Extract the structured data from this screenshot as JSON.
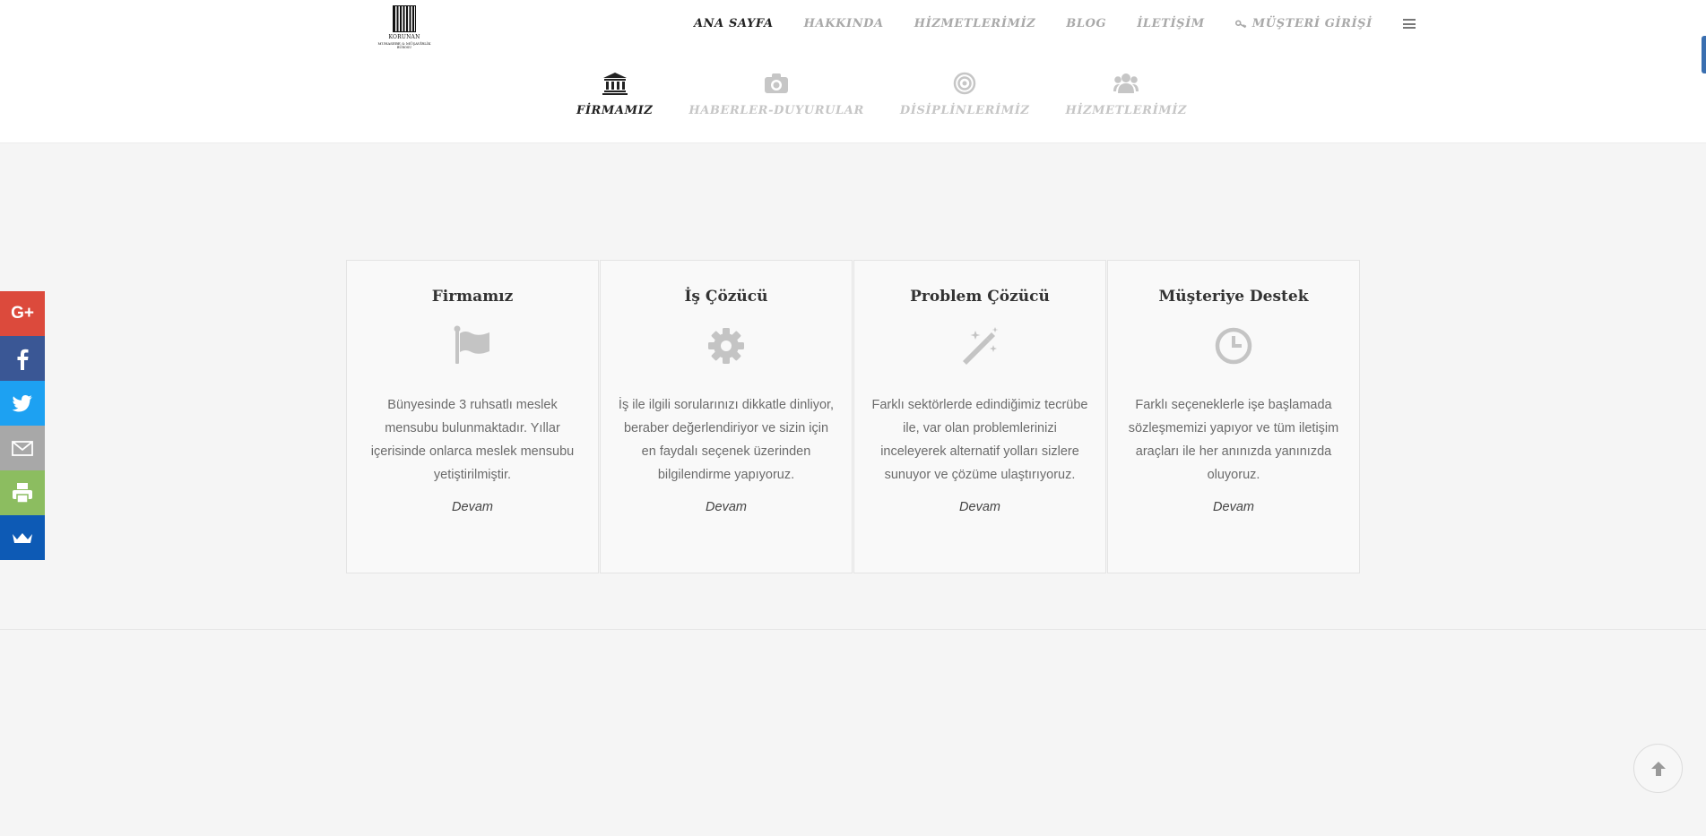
{
  "logo": {
    "name": "KORUNAN",
    "line1": "MUHASEBE & MÜŞAVİRLİK",
    "line2": "BÜROSU"
  },
  "nav": {
    "items": [
      {
        "label": "ANA SAYFA",
        "active": true
      },
      {
        "label": "HAKKINDA"
      },
      {
        "label": "HİZMETLERİMİZ"
      },
      {
        "label": "BLOG"
      },
      {
        "label": "İLETİŞİM"
      },
      {
        "label": "MÜŞTERİ GİRİŞİ",
        "icon": "key-icon"
      }
    ],
    "menu_icon": "hamburger-menu-icon"
  },
  "subtabs": [
    {
      "label": "FİRMAMIZ",
      "icon": "bank-icon",
      "active": true
    },
    {
      "label": "HABERLER-DUYURULAR",
      "icon": "camera-icon"
    },
    {
      "label": "DİSİPLİNLERİMİZ",
      "icon": "target-icon"
    },
    {
      "label": "HİZMETLERİMİZ",
      "icon": "users-icon"
    }
  ],
  "features": [
    {
      "title": "Firmamız",
      "icon": "flag-icon",
      "text": "Bünyesinde 3 ruhsatlı meslek mensubu bulunmaktadır. Yıllar içerisinde onlarca meslek mensubu yetiştirilmiştir.",
      "link": "Devam"
    },
    {
      "title": "İş Çözücü",
      "icon": "gear-icon",
      "text": "İş ile ilgili sorularınızı dikkatle dinliyor, beraber değerlendiriyor ve sizin için en faydalı seçenek üzerinden bilgilendirme yapıyoruz.",
      "link": "Devam"
    },
    {
      "title": "Problem Çözücü",
      "icon": "magic-wand-icon",
      "text": "Farklı sektörlerde edindiğimiz tecrübe ile, var olan problemlerinizi inceleyerek alternatif yolları sizlere sunuyor ve çözüme ulaştırıyoruz.",
      "link": "Devam"
    },
    {
      "title": "Müşteriye Destek",
      "icon": "clock-icon",
      "text": "Farklı seçeneklerle işe başlamada sözleşmemizi yapıyor ve tüm iletişim araçları ile her anınızda yanınızda oluyoruz.",
      "link": "Devam"
    }
  ],
  "social": [
    {
      "network": "google-plus",
      "glyph": "G+",
      "color": "#dc4a3c"
    },
    {
      "network": "facebook",
      "color": "#3a5795"
    },
    {
      "network": "twitter",
      "color": "#1da1f2"
    },
    {
      "network": "email",
      "color": "#a8a8a8"
    },
    {
      "network": "print",
      "color": "#8cbd60"
    },
    {
      "network": "sumome",
      "color": "#0d5ab5"
    }
  ],
  "scroll_top_icon": "arrow-up-icon"
}
